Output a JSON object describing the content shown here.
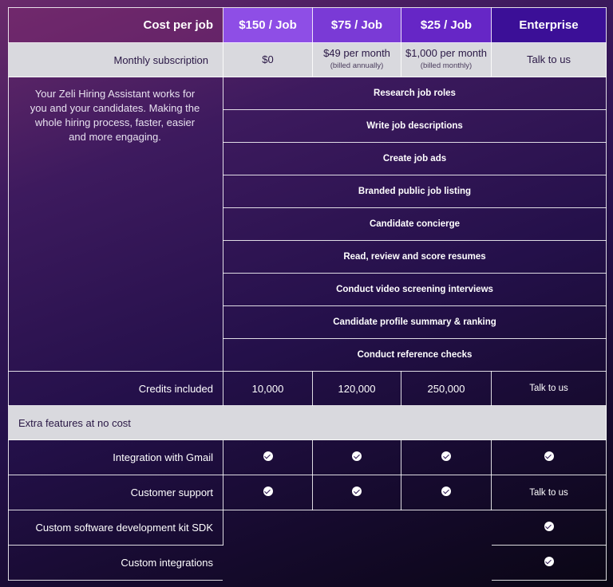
{
  "header": {
    "label": "Cost per job",
    "plans": [
      "$150 / Job",
      "$75 / Job",
      "$25 / Job",
      "Enterprise"
    ]
  },
  "subscription": {
    "label": "Monthly subscription",
    "prices": [
      {
        "main": "$0",
        "note": ""
      },
      {
        "main": "$49 per month",
        "note": "(billed annually)"
      },
      {
        "main": "$1,000 per month",
        "note": "(billed monthly)"
      },
      {
        "main": "Talk to us",
        "note": ""
      }
    ]
  },
  "intro": "Your Zeli Hiring Assistant works for you and your candidates. Making the whole hiring process, faster, easier and more engaging.",
  "features": [
    "Research job roles",
    "Write job descriptions",
    "Create job ads",
    "Branded public job listing",
    "Candidate concierge",
    "Read, review and score resumes",
    "Conduct video screening interviews",
    "Candidate profile summary & ranking",
    "Conduct reference checks"
  ],
  "credits": {
    "label": "Credits included",
    "values": [
      "10,000",
      "120,000",
      "250,000",
      "Talk to us"
    ]
  },
  "extras": {
    "section_label": "Extra features at no cost",
    "gmail_label": "Integration with Gmail",
    "support_label": "Customer support",
    "support_enterprise": "Talk to us",
    "sdk_label": "Custom software development kit SDK",
    "integrations_label": "Custom integrations"
  },
  "colors": {
    "plan1": "#8e4ee6",
    "plan2": "#7a3ad6",
    "plan3": "#6626c6",
    "enterprise": "#3b0f97",
    "light_row": "#d9d9de"
  },
  "icons": {
    "included": "check-circle-icon"
  }
}
